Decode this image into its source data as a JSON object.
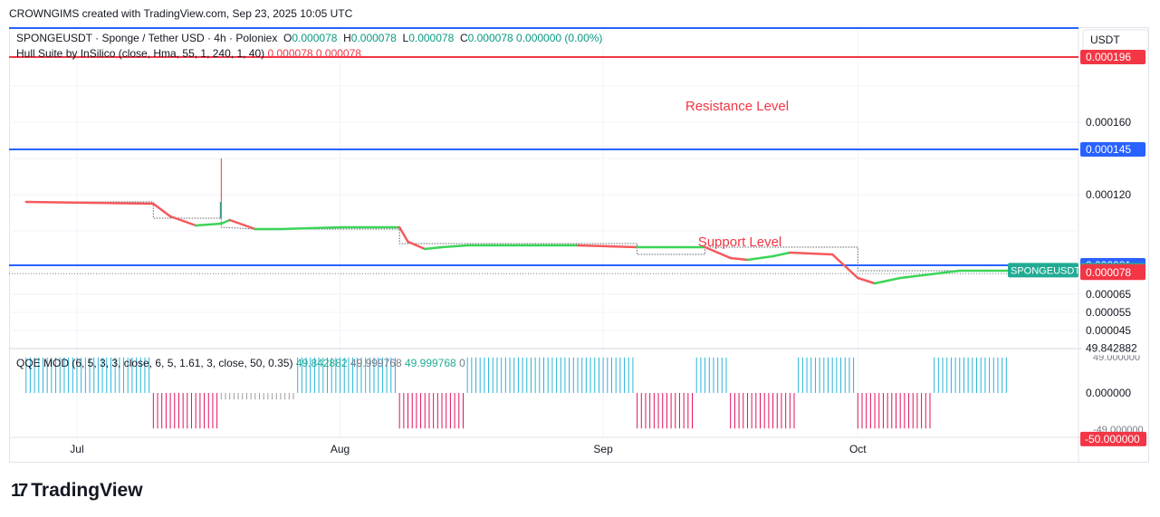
{
  "header": {
    "credit": "CROWNGIMS created with TradingView.com, Sep 23, 2025 10:05 UTC"
  },
  "legend": {
    "symbol": "SPONGEUSDT · Sponge / Tether USD · 4h · Poloniex",
    "o_label": "O",
    "o": "0.000078",
    "h_label": "H",
    "h": "0.000078",
    "l_label": "L",
    "l": "0.000078",
    "c_label": "C",
    "c": "0.000078",
    "change": "0.000000 (0.00%)",
    "indicator": "Hull Suite by InSilico (close, Hma, 55, 1, 240, 1, 40)",
    "ind_v1": "0.000078",
    "ind_v2": "0.000078",
    "qqe": "QQE MOD (6, 5, 3, 3, close, 6, 5, 1.61, 3, close, 50, 0.35)",
    "qqe_v1": "49.842882",
    "qqe_v2": "49.999768",
    "qqe_v3": "49.999768",
    "qqe_v4": "0"
  },
  "axis": {
    "currency": "USDT",
    "price_ticks": [
      "0.000160",
      "0.000120",
      "0.000065",
      "0.000055",
      "0.000045"
    ],
    "price_tick_values": [
      0.00016,
      0.00012,
      6.5e-05,
      5.5e-05,
      4.5e-05
    ],
    "badges": [
      {
        "text": "0.000196",
        "value": 0.000196,
        "color": "#f23645"
      },
      {
        "text": "0.000145",
        "value": 0.000145,
        "color": "#2962ff"
      },
      {
        "text": "0.000081",
        "value": 8.1e-05,
        "color": "#2962ff"
      },
      {
        "text": "0.000078",
        "value": 7.83e-05,
        "color": "#22ab94",
        "label": "SPONGEUSDT"
      },
      {
        "text": "0.000078",
        "value": 7.76e-05,
        "color": "#f23645"
      },
      {
        "text": "0.000078",
        "value": 7.69e-05,
        "color": "#f23645"
      }
    ],
    "qqe_ticks": [
      "49.842882",
      "0.000000",
      "-50.000000"
    ],
    "qqe_tick_values": [
      49.842882,
      0,
      -50
    ],
    "qqe_overlap_ticks": [
      "49.000000",
      "-49.000000"
    ],
    "time_ticks": [
      {
        "label": "Jul",
        "day": 6
      },
      {
        "label": "Aug",
        "day": 37
      },
      {
        "label": "Sep",
        "day": 68
      },
      {
        "label": "Oct",
        "day": 98
      }
    ]
  },
  "annotations": {
    "resistance": "Resistance Level",
    "support": "Support Level"
  },
  "levels": {
    "top_line": 0.000196,
    "resistance": 0.000145,
    "support": 8.1e-05
  },
  "chart_data": {
    "type": "line",
    "title": "",
    "x_unit": "days since Jun 25, 2025",
    "price_range": [
      3.5e-05,
      0.000212
    ],
    "hull_suite": {
      "x": [
        0,
        15,
        17,
        20,
        23,
        24,
        27,
        30,
        37,
        44,
        45,
        47,
        49,
        52,
        55,
        60,
        65,
        72,
        80,
        83,
        85,
        88,
        90,
        95,
        98,
        100,
        103,
        110,
        113,
        115,
        116
      ],
      "y": [
        0.000116,
        0.000115,
        0.000108,
        0.000103,
        0.000104,
        0.000106,
        0.000101,
        0.000101,
        0.000102,
        0.000102,
        9.4e-05,
        9e-05,
        9.1e-05,
        9.2e-05,
        9.2e-05,
        9.2e-05,
        9.2e-05,
        9.1e-05,
        9.1e-05,
        8.5e-05,
        8.4e-05,
        8.6e-05,
        8.8e-05,
        8.7e-05,
        7.4e-05,
        7.1e-05,
        7.4e-05,
        7.8e-05,
        7.8e-05,
        7.8e-05,
        7.8e-05
      ]
    },
    "price_steps": {
      "x": [
        0,
        15,
        15,
        23,
        23,
        27,
        30,
        44,
        44,
        72,
        72,
        80,
        80,
        98,
        98,
        116
      ],
      "y": [
        0.000116,
        0.000116,
        0.000107,
        0.000107,
        0.000102,
        0.000101,
        0.000101,
        0.000101,
        9.3e-05,
        9.3e-05,
        8.7e-05,
        8.7e-05,
        9.1e-05,
        9.1e-05,
        7.8e-05,
        7.8e-05
      ]
    },
    "wick": {
      "x": 23,
      "high": 0.00014,
      "low": 0.000107
    },
    "qqe_histogram": {
      "range": [
        -60,
        60
      ],
      "segments": [
        {
          "start": 0,
          "end": 15,
          "value": 48,
          "color": "#2ab3d8"
        },
        {
          "start": 15,
          "end": 23,
          "value": -48,
          "color": "#e0115f"
        },
        {
          "start": 23,
          "end": 32,
          "value": -9,
          "color": "#9e9e9e"
        },
        {
          "start": 32,
          "end": 44,
          "value": 48,
          "color": "#2ab3d8"
        },
        {
          "start": 44,
          "end": 52,
          "value": -48,
          "color": "#e0115f"
        },
        {
          "start": 52,
          "end": 72,
          "value": 48,
          "color": "#2ab3d8"
        },
        {
          "start": 72,
          "end": 79,
          "value": -48,
          "color": "#e0115f"
        },
        {
          "start": 79,
          "end": 83,
          "value": 48,
          "color": "#2ab3d8"
        },
        {
          "start": 83,
          "end": 91,
          "value": -48,
          "color": "#e0115f"
        },
        {
          "start": 91,
          "end": 98,
          "value": 48,
          "color": "#2ab3d8"
        },
        {
          "start": 98,
          "end": 107,
          "value": -48,
          "color": "#e0115f"
        },
        {
          "start": 107,
          "end": 116,
          "value": 48,
          "color": "#2ab3d8"
        }
      ]
    }
  },
  "brand": {
    "name": "TradingView",
    "mark": "17"
  }
}
